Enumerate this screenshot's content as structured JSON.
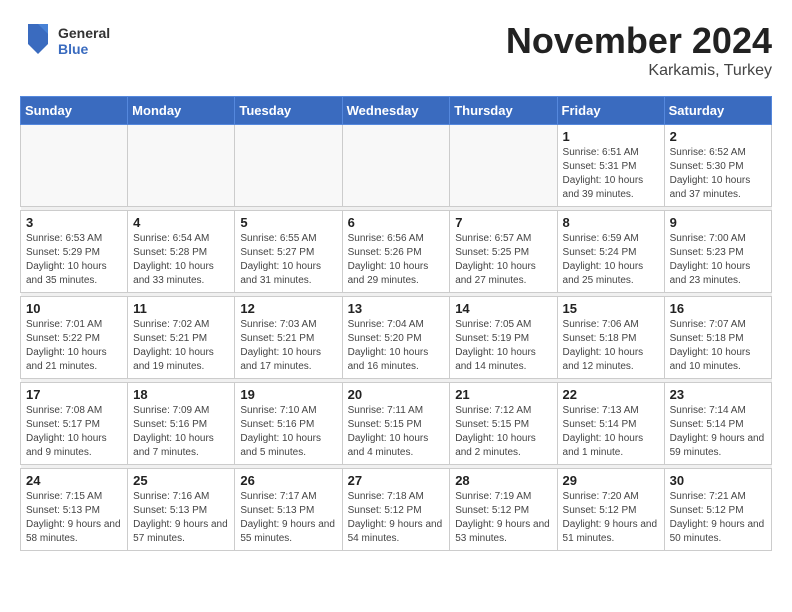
{
  "logo": {
    "text1": "General",
    "text2": "Blue"
  },
  "title": "November 2024",
  "subtitle": "Karkamis, Turkey",
  "weekdays": [
    "Sunday",
    "Monday",
    "Tuesday",
    "Wednesday",
    "Thursday",
    "Friday",
    "Saturday"
  ],
  "weeks": [
    [
      {
        "day": "",
        "info": ""
      },
      {
        "day": "",
        "info": ""
      },
      {
        "day": "",
        "info": ""
      },
      {
        "day": "",
        "info": ""
      },
      {
        "day": "",
        "info": ""
      },
      {
        "day": "1",
        "info": "Sunrise: 6:51 AM\nSunset: 5:31 PM\nDaylight: 10 hours and 39 minutes."
      },
      {
        "day": "2",
        "info": "Sunrise: 6:52 AM\nSunset: 5:30 PM\nDaylight: 10 hours and 37 minutes."
      }
    ],
    [
      {
        "day": "3",
        "info": "Sunrise: 6:53 AM\nSunset: 5:29 PM\nDaylight: 10 hours and 35 minutes."
      },
      {
        "day": "4",
        "info": "Sunrise: 6:54 AM\nSunset: 5:28 PM\nDaylight: 10 hours and 33 minutes."
      },
      {
        "day": "5",
        "info": "Sunrise: 6:55 AM\nSunset: 5:27 PM\nDaylight: 10 hours and 31 minutes."
      },
      {
        "day": "6",
        "info": "Sunrise: 6:56 AM\nSunset: 5:26 PM\nDaylight: 10 hours and 29 minutes."
      },
      {
        "day": "7",
        "info": "Sunrise: 6:57 AM\nSunset: 5:25 PM\nDaylight: 10 hours and 27 minutes."
      },
      {
        "day": "8",
        "info": "Sunrise: 6:59 AM\nSunset: 5:24 PM\nDaylight: 10 hours and 25 minutes."
      },
      {
        "day": "9",
        "info": "Sunrise: 7:00 AM\nSunset: 5:23 PM\nDaylight: 10 hours and 23 minutes."
      }
    ],
    [
      {
        "day": "10",
        "info": "Sunrise: 7:01 AM\nSunset: 5:22 PM\nDaylight: 10 hours and 21 minutes."
      },
      {
        "day": "11",
        "info": "Sunrise: 7:02 AM\nSunset: 5:21 PM\nDaylight: 10 hours and 19 minutes."
      },
      {
        "day": "12",
        "info": "Sunrise: 7:03 AM\nSunset: 5:21 PM\nDaylight: 10 hours and 17 minutes."
      },
      {
        "day": "13",
        "info": "Sunrise: 7:04 AM\nSunset: 5:20 PM\nDaylight: 10 hours and 16 minutes."
      },
      {
        "day": "14",
        "info": "Sunrise: 7:05 AM\nSunset: 5:19 PM\nDaylight: 10 hours and 14 minutes."
      },
      {
        "day": "15",
        "info": "Sunrise: 7:06 AM\nSunset: 5:18 PM\nDaylight: 10 hours and 12 minutes."
      },
      {
        "day": "16",
        "info": "Sunrise: 7:07 AM\nSunset: 5:18 PM\nDaylight: 10 hours and 10 minutes."
      }
    ],
    [
      {
        "day": "17",
        "info": "Sunrise: 7:08 AM\nSunset: 5:17 PM\nDaylight: 10 hours and 9 minutes."
      },
      {
        "day": "18",
        "info": "Sunrise: 7:09 AM\nSunset: 5:16 PM\nDaylight: 10 hours and 7 minutes."
      },
      {
        "day": "19",
        "info": "Sunrise: 7:10 AM\nSunset: 5:16 PM\nDaylight: 10 hours and 5 minutes."
      },
      {
        "day": "20",
        "info": "Sunrise: 7:11 AM\nSunset: 5:15 PM\nDaylight: 10 hours and 4 minutes."
      },
      {
        "day": "21",
        "info": "Sunrise: 7:12 AM\nSunset: 5:15 PM\nDaylight: 10 hours and 2 minutes."
      },
      {
        "day": "22",
        "info": "Sunrise: 7:13 AM\nSunset: 5:14 PM\nDaylight: 10 hours and 1 minute."
      },
      {
        "day": "23",
        "info": "Sunrise: 7:14 AM\nSunset: 5:14 PM\nDaylight: 9 hours and 59 minutes."
      }
    ],
    [
      {
        "day": "24",
        "info": "Sunrise: 7:15 AM\nSunset: 5:13 PM\nDaylight: 9 hours and 58 minutes."
      },
      {
        "day": "25",
        "info": "Sunrise: 7:16 AM\nSunset: 5:13 PM\nDaylight: 9 hours and 57 minutes."
      },
      {
        "day": "26",
        "info": "Sunrise: 7:17 AM\nSunset: 5:13 PM\nDaylight: 9 hours and 55 minutes."
      },
      {
        "day": "27",
        "info": "Sunrise: 7:18 AM\nSunset: 5:12 PM\nDaylight: 9 hours and 54 minutes."
      },
      {
        "day": "28",
        "info": "Sunrise: 7:19 AM\nSunset: 5:12 PM\nDaylight: 9 hours and 53 minutes."
      },
      {
        "day": "29",
        "info": "Sunrise: 7:20 AM\nSunset: 5:12 PM\nDaylight: 9 hours and 51 minutes."
      },
      {
        "day": "30",
        "info": "Sunrise: 7:21 AM\nSunset: 5:12 PM\nDaylight: 9 hours and 50 minutes."
      }
    ]
  ]
}
